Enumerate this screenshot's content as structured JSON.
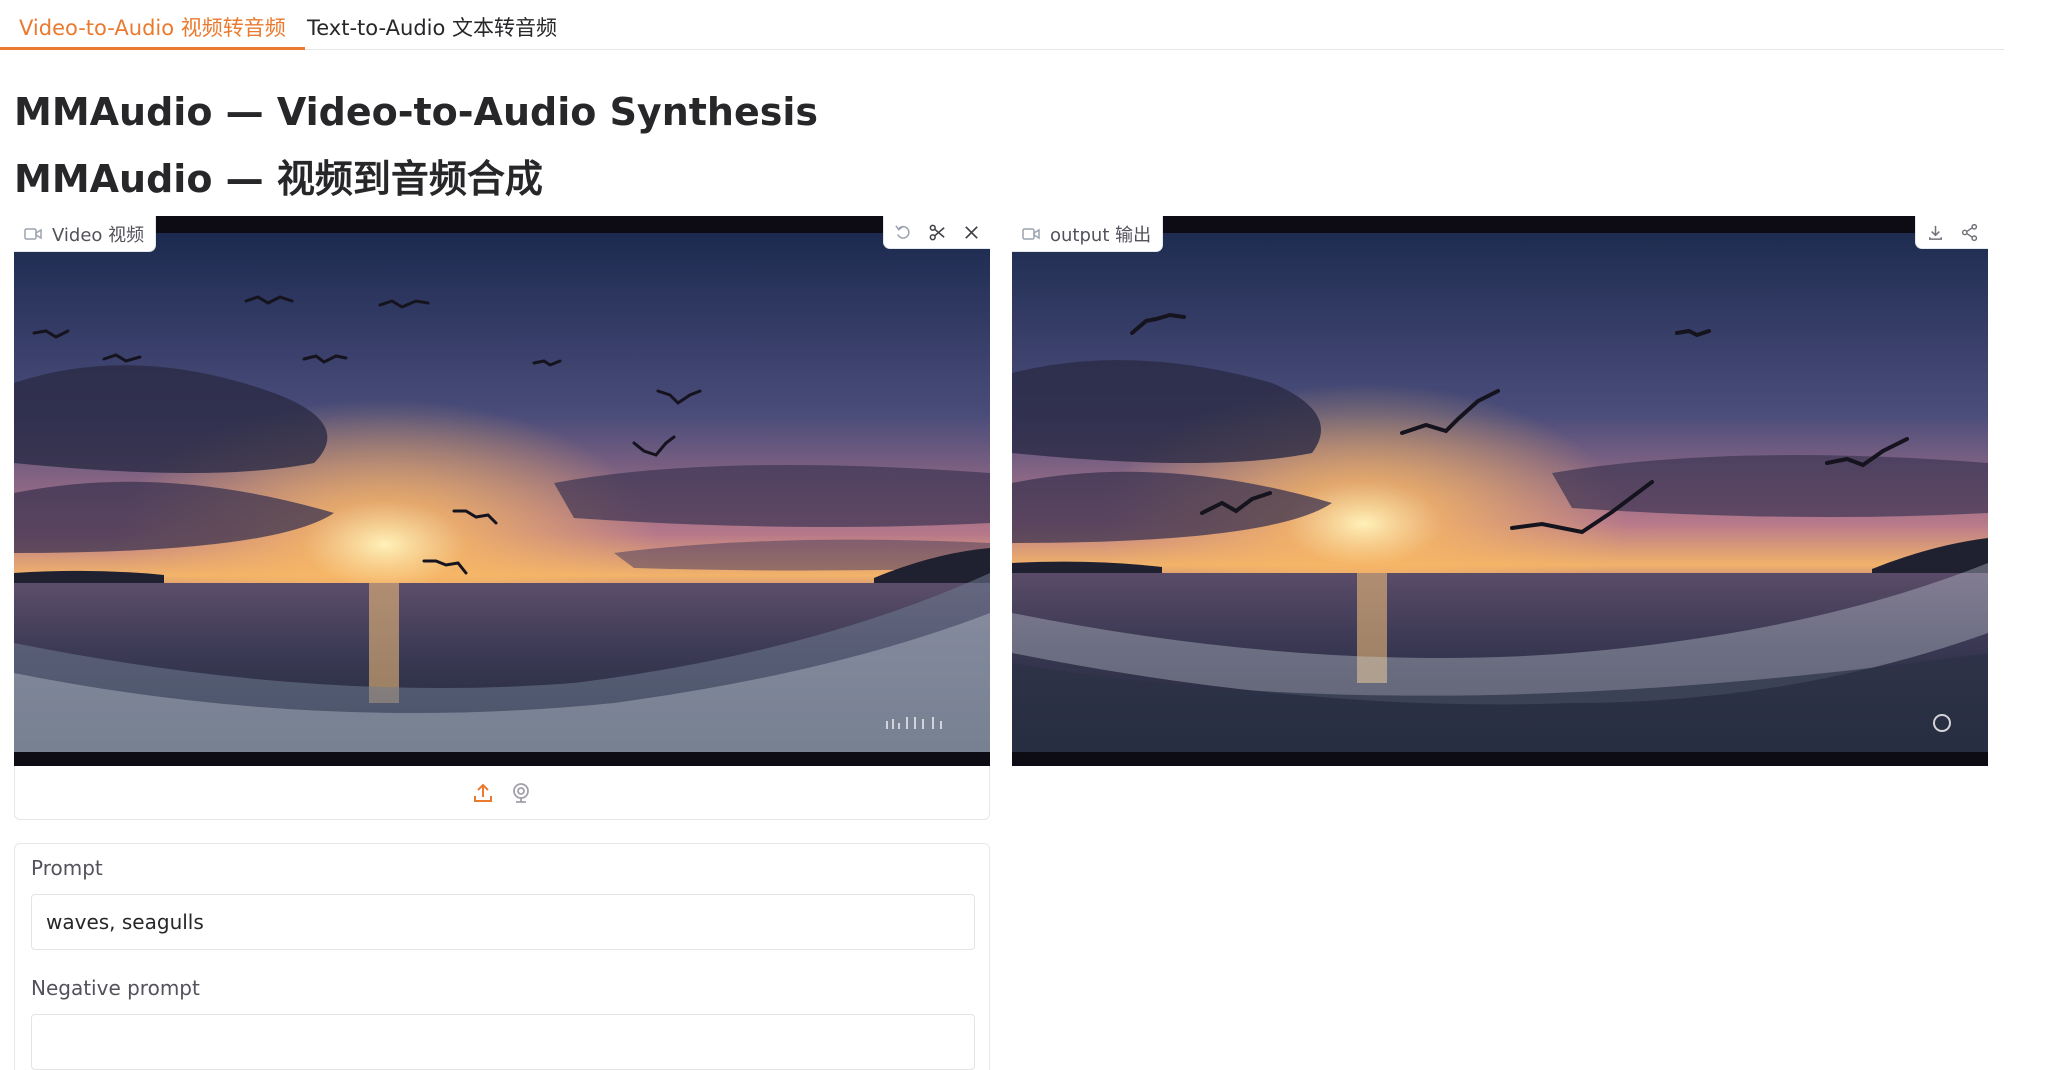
{
  "tabs": [
    {
      "label": "Video-to-Audio 视频转音频",
      "active": true
    },
    {
      "label": "Text-to-Audio 文本转音频",
      "active": false
    }
  ],
  "title_line1": "MMAudio — Video-to-Audio Synthesis",
  "title_line2": "MMAudio — 视频到音频合成",
  "input_video": {
    "label": "Video 视频",
    "label_icon": "video-camera-icon",
    "tools": [
      "undo-icon",
      "scissors-icon",
      "close-icon"
    ],
    "sources": [
      "upload-icon",
      "webcam-icon"
    ]
  },
  "output_video": {
    "label": "output 输出",
    "label_icon": "video-camera-icon",
    "tools": [
      "download-icon",
      "share-icon"
    ]
  },
  "prompt": {
    "label": "Prompt",
    "value": "waves, seagulls",
    "placeholder": ""
  },
  "negative_prompt": {
    "label": "Negative prompt",
    "value": "",
    "placeholder": ""
  },
  "colors": {
    "accent": "#ea7a2f",
    "text": "#27272a",
    "muted": "#52525b",
    "border": "#e5e7eb"
  }
}
